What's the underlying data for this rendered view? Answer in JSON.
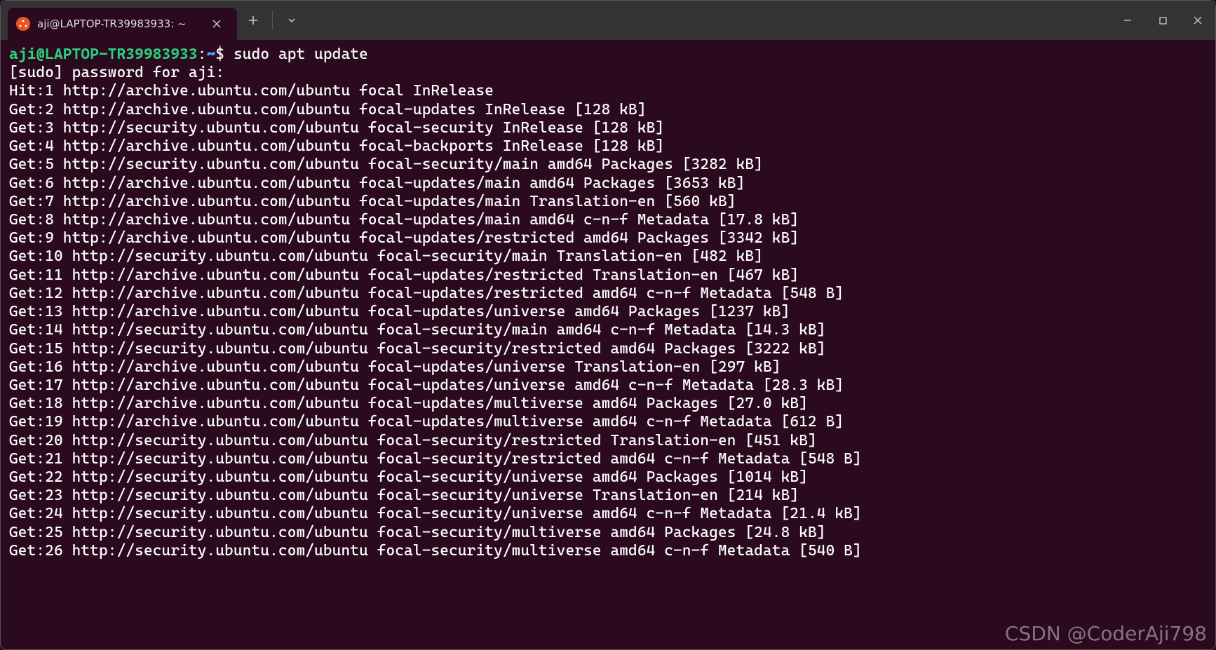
{
  "tab": {
    "title": "aji@LAPTOP-TR39983933: ~"
  },
  "prompt": {
    "user": "aji",
    "at": "@",
    "host": "LAPTOP-TR39983933",
    "colon": ":",
    "path": "~",
    "dollar": "$",
    "command": "sudo apt update"
  },
  "lines": [
    "[sudo] password for aji:",
    "Hit:1 http://archive.ubuntu.com/ubuntu focal InRelease",
    "Get:2 http://archive.ubuntu.com/ubuntu focal-updates InRelease [128 kB]",
    "Get:3 http://security.ubuntu.com/ubuntu focal-security InRelease [128 kB]",
    "Get:4 http://archive.ubuntu.com/ubuntu focal-backports InRelease [128 kB]",
    "Get:5 http://security.ubuntu.com/ubuntu focal-security/main amd64 Packages [3282 kB]",
    "Get:6 http://archive.ubuntu.com/ubuntu focal-updates/main amd64 Packages [3653 kB]",
    "Get:7 http://archive.ubuntu.com/ubuntu focal-updates/main Translation-en [560 kB]",
    "Get:8 http://archive.ubuntu.com/ubuntu focal-updates/main amd64 c-n-f Metadata [17.8 kB]",
    "Get:9 http://archive.ubuntu.com/ubuntu focal-updates/restricted amd64 Packages [3342 kB]",
    "Get:10 http://security.ubuntu.com/ubuntu focal-security/main Translation-en [482 kB]",
    "Get:11 http://archive.ubuntu.com/ubuntu focal-updates/restricted Translation-en [467 kB]",
    "Get:12 http://archive.ubuntu.com/ubuntu focal-updates/restricted amd64 c-n-f Metadata [548 B]",
    "Get:13 http://archive.ubuntu.com/ubuntu focal-updates/universe amd64 Packages [1237 kB]",
    "Get:14 http://security.ubuntu.com/ubuntu focal-security/main amd64 c-n-f Metadata [14.3 kB]",
    "Get:15 http://security.ubuntu.com/ubuntu focal-security/restricted amd64 Packages [3222 kB]",
    "Get:16 http://archive.ubuntu.com/ubuntu focal-updates/universe Translation-en [297 kB]",
    "Get:17 http://archive.ubuntu.com/ubuntu focal-updates/universe amd64 c-n-f Metadata [28.3 kB]",
    "Get:18 http://archive.ubuntu.com/ubuntu focal-updates/multiverse amd64 Packages [27.0 kB]",
    "Get:19 http://archive.ubuntu.com/ubuntu focal-updates/multiverse amd64 c-n-f Metadata [612 B]",
    "Get:20 http://security.ubuntu.com/ubuntu focal-security/restricted Translation-en [451 kB]",
    "Get:21 http://security.ubuntu.com/ubuntu focal-security/restricted amd64 c-n-f Metadata [548 B]",
    "Get:22 http://security.ubuntu.com/ubuntu focal-security/universe amd64 Packages [1014 kB]",
    "Get:23 http://security.ubuntu.com/ubuntu focal-security/universe Translation-en [214 kB]",
    "Get:24 http://security.ubuntu.com/ubuntu focal-security/universe amd64 c-n-f Metadata [21.4 kB]",
    "Get:25 http://security.ubuntu.com/ubuntu focal-security/multiverse amd64 Packages [24.8 kB]",
    "Get:26 http://security.ubuntu.com/ubuntu focal-security/multiverse amd64 c-n-f Metadata [540 B]"
  ],
  "watermark": "CSDN @CoderAji798"
}
